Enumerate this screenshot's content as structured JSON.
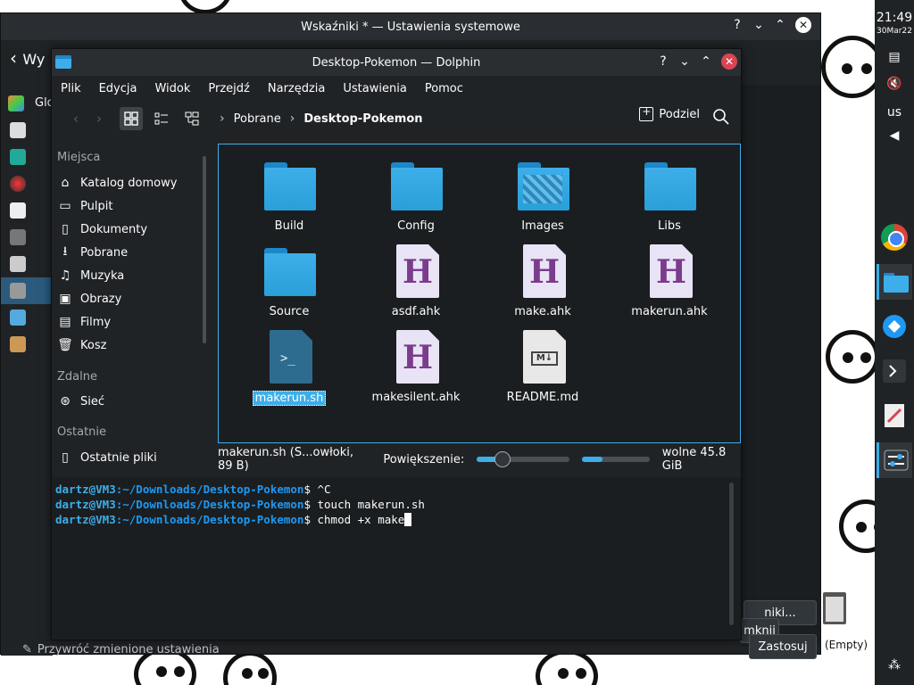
{
  "settings_window": {
    "title": "Wskaźniki * — Ustawienia systemowe",
    "back_label": "Wy",
    "sidebar_first": "Glo",
    "button_partial_1": "niki...",
    "button_partial_2": "mknij",
    "button_partial_3": "Zastosuj",
    "reset_label": "Przywróć zmienione ustawienia"
  },
  "dolphin": {
    "title": "Desktop-Pokemon — Dolphin",
    "menu": [
      "Plik",
      "Edycja",
      "Widok",
      "Przejdź",
      "Narzędzia",
      "Ustawienia",
      "Pomoc"
    ],
    "breadcrumb": [
      "Pobrane",
      "Desktop-Pokemon"
    ],
    "split_label": "Podziel",
    "places": {
      "header_places": "Miejsca",
      "items": [
        "Katalog domowy",
        "Pulpit",
        "Dokumenty",
        "Pobrane",
        "Muzyka",
        "Obrazy",
        "Filmy",
        "Kosz"
      ],
      "header_remote": "Zdalne",
      "remote_items": [
        "Sieć"
      ],
      "header_recent": "Ostatnie",
      "recent_items": [
        "Ostatnie pliki"
      ]
    },
    "files": [
      {
        "name": "Build",
        "type": "folder"
      },
      {
        "name": "Config",
        "type": "folder"
      },
      {
        "name": "Images",
        "type": "folder-images"
      },
      {
        "name": "Libs",
        "type": "folder"
      },
      {
        "name": "Source",
        "type": "folder"
      },
      {
        "name": "asdf.ahk",
        "type": "ahk"
      },
      {
        "name": "make.ahk",
        "type": "ahk"
      },
      {
        "name": "makerun.ahk",
        "type": "ahk"
      },
      {
        "name": "makerun.sh",
        "type": "sh",
        "selected": true
      },
      {
        "name": "makesilent.ahk",
        "type": "ahk"
      },
      {
        "name": "README.md",
        "type": "md"
      }
    ],
    "status": {
      "selection": "makerun.sh (S...owłoki, 89 B)",
      "zoom_label": "Powiększenie:",
      "zoom_level": 0.28,
      "disk_used": 0.3,
      "free_label": "wolne 45.8 GiB"
    },
    "terminal": {
      "prompt_user": "dartz@VM3",
      "prompt_path": ":~/Downloads/Desktop-Pokemon",
      "lines": [
        "$ ^C",
        "$ touch makerun.sh",
        "$ chmod +x make"
      ]
    }
  },
  "panel": {
    "time": "21:49",
    "date": "30Mar22",
    "keyboard": "us",
    "trash_label": "(Empty)"
  },
  "colors": {
    "accent": "#3daee9",
    "window_bg": "#202326",
    "close_red": "#da4453"
  }
}
